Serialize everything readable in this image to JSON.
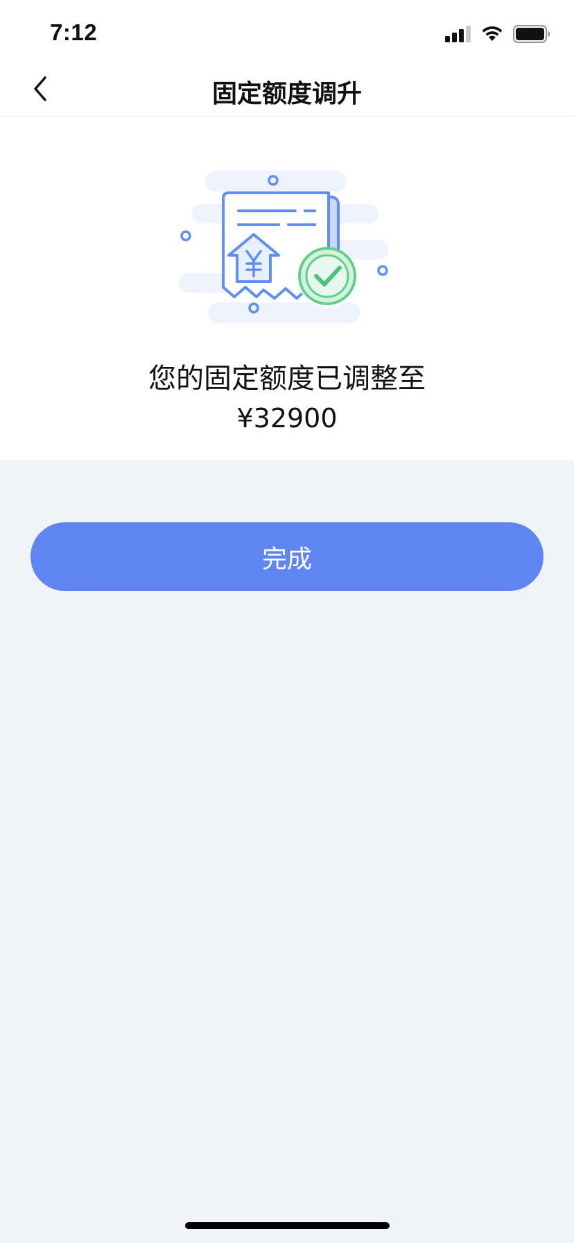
{
  "status_bar": {
    "time": "7:12",
    "icons": [
      "signal-icon",
      "wifi-icon",
      "battery-icon"
    ]
  },
  "nav": {
    "title": "固定额度调升",
    "back_icon": "chevron-left-icon"
  },
  "result": {
    "message": "您的固定额度已调整至",
    "amount": "¥32900",
    "illustration_icon": "receipt-success-icon"
  },
  "actions": {
    "done_label": "完成"
  },
  "colors": {
    "accent": "#5f85f2",
    "success": "#5fd08a",
    "background": "#f1f3f7"
  }
}
